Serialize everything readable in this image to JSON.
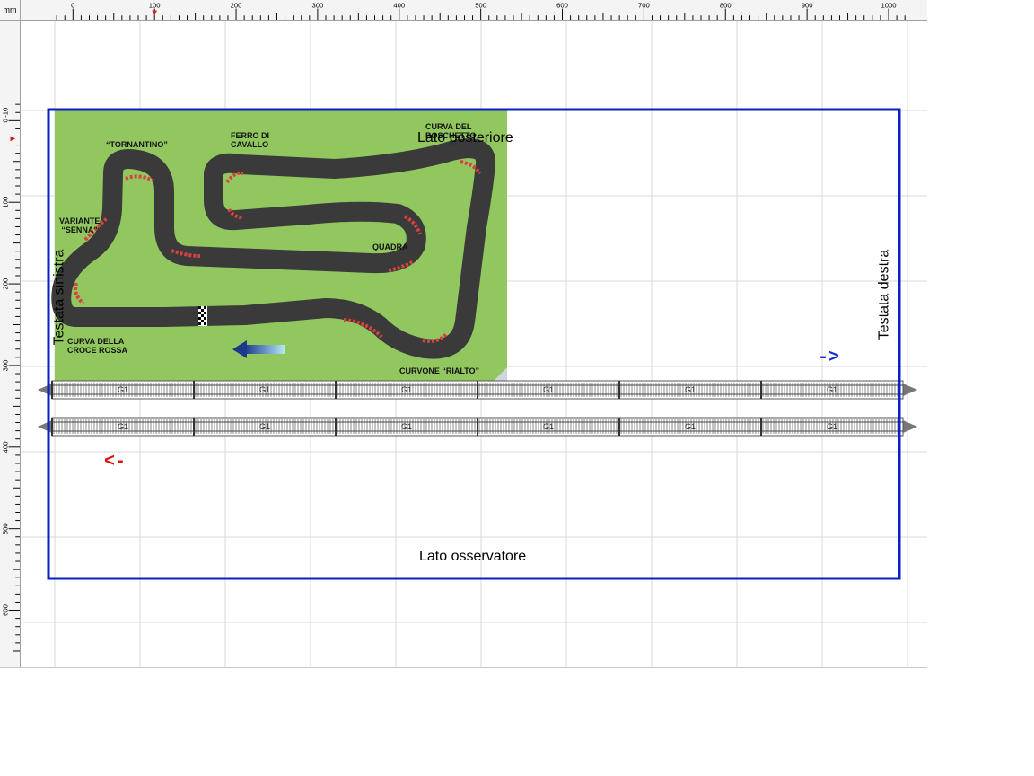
{
  "ruler": {
    "unit": "mm",
    "top_ticks": [
      "0",
      "100",
      "200",
      "300",
      "400",
      "500",
      "600",
      "700",
      "800",
      "900",
      "1000"
    ],
    "left_ticks": [
      "-10",
      "0",
      "100",
      "200",
      "300",
      "400",
      "500",
      "600"
    ]
  },
  "layout_labels": {
    "back_side": "Lato posteriore",
    "observer_side": "Lato osservatore",
    "left_end": "Testata sinistra",
    "right_end": "Testata destra"
  },
  "direction_arrows": {
    "right": "->",
    "left": "<-",
    "right_color": "#1a2fd0",
    "left_color": "#e01010"
  },
  "track_image": {
    "labels": {
      "tornantino": "“TORNANTINO”",
      "ferro": "FERRO DI\nCAVALLO",
      "boschetto": "CURVA DEL\nBOSCHETTO",
      "senna": "VARIANTE\n“SENNA”",
      "quadra": "QUADRA",
      "croce": "CURVA DELLA\nCROCE ROSSA",
      "rialto": "CURVONE “RIALTO”"
    },
    "grass_color": "#92c760",
    "asphalt_color": "#3a3a3a"
  },
  "straights": {
    "piece_label": "G1",
    "count_per_lane": 6
  },
  "colors": {
    "border_blue": "#0a1fc4",
    "grid": "#d8d8d8"
  }
}
